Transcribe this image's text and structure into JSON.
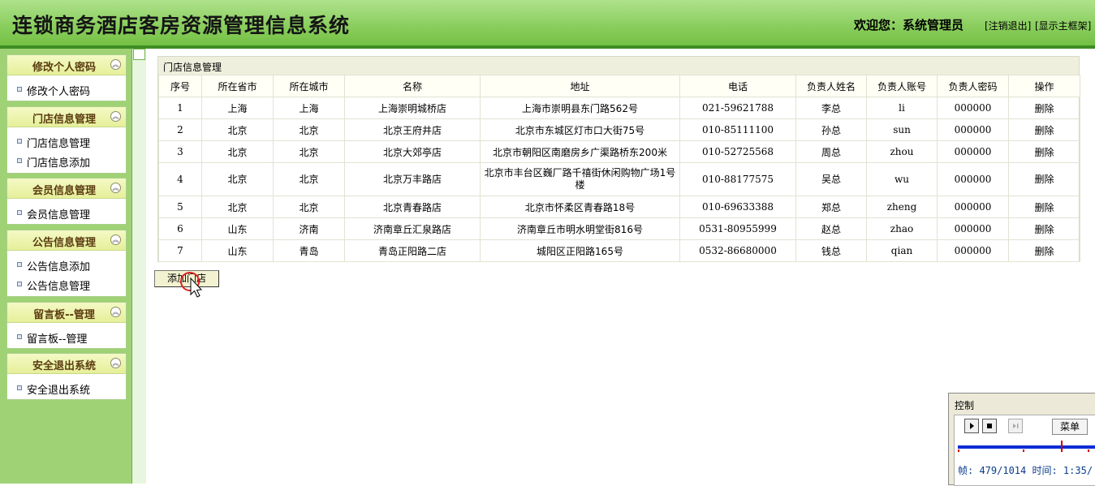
{
  "header": {
    "title": "连锁商务酒店客房资源管理信息系统",
    "welcome": "欢迎您：系统管理员",
    "logout": "[注销退出]",
    "show_frame": "[显示主框架]"
  },
  "sidebar": [
    {
      "title": "修改个人密码",
      "items": [
        "修改个人密码"
      ]
    },
    {
      "title": "门店信息管理",
      "items": [
        "门店信息管理",
        "门店信息添加"
      ]
    },
    {
      "title": "会员信息管理",
      "items": [
        "会员信息管理"
      ]
    },
    {
      "title": "公告信息管理",
      "items": [
        "公告信息添加",
        "公告信息管理"
      ]
    },
    {
      "title": "留言板--管理",
      "items": [
        "留言板--管理"
      ]
    },
    {
      "title": "安全退出系统",
      "items": [
        "安全退出系统"
      ]
    }
  ],
  "main": {
    "section_title": "门店信息管理",
    "columns": [
      "序号",
      "所在省市",
      "所在城市",
      "名称",
      "地址",
      "电话",
      "负责人姓名",
      "负责人账号",
      "负责人密码",
      "操作"
    ],
    "rows": [
      [
        "1",
        "上海",
        "上海",
        "上海崇明城桥店",
        "上海市崇明县东门路562号",
        "021-59621788",
        "李总",
        "li",
        "000000",
        "删除"
      ],
      [
        "2",
        "北京",
        "北京",
        "北京王府井店",
        "北京市东城区灯市口大街75号",
        "010-85111100",
        "孙总",
        "sun",
        "000000",
        "删除"
      ],
      [
        "3",
        "北京",
        "北京",
        "北京大郊亭店",
        "北京市朝阳区南磨房乡广渠路桥东200米",
        "010-52725568",
        "周总",
        "zhou",
        "000000",
        "删除"
      ],
      [
        "4",
        "北京",
        "北京",
        "北京万丰路店",
        "北京市丰台区巍厂路千禧街休闲购物广场1号楼",
        "010-88177575",
        "吴总",
        "wu",
        "000000",
        "删除"
      ],
      [
        "5",
        "北京",
        "北京",
        "北京青春路店",
        "北京市怀柔区青春路18号",
        "010-69633388",
        "郑总",
        "zheng",
        "000000",
        "删除"
      ],
      [
        "6",
        "山东",
        "济南",
        "济南章丘汇泉路店",
        "济南章丘市明水明堂街816号",
        "0531-80955999",
        "赵总",
        "zhao",
        "000000",
        "删除"
      ],
      [
        "7",
        "山东",
        "青岛",
        "青岛正阳路二店",
        "城阳区正阳路165号",
        "0532-86680000",
        "钱总",
        "qian",
        "000000",
        "删除"
      ]
    ],
    "add_button": "添加门店"
  },
  "control": {
    "title": "控制",
    "menu_label": "菜单",
    "frame_info": "帧: 479/1014 时间: 1:35/"
  },
  "colors": {
    "header_green": "#8ccf60",
    "sidebar_green": "#9fd274",
    "panel_header": "#e6ef9a",
    "progress_blue": "#0c2cd6"
  }
}
